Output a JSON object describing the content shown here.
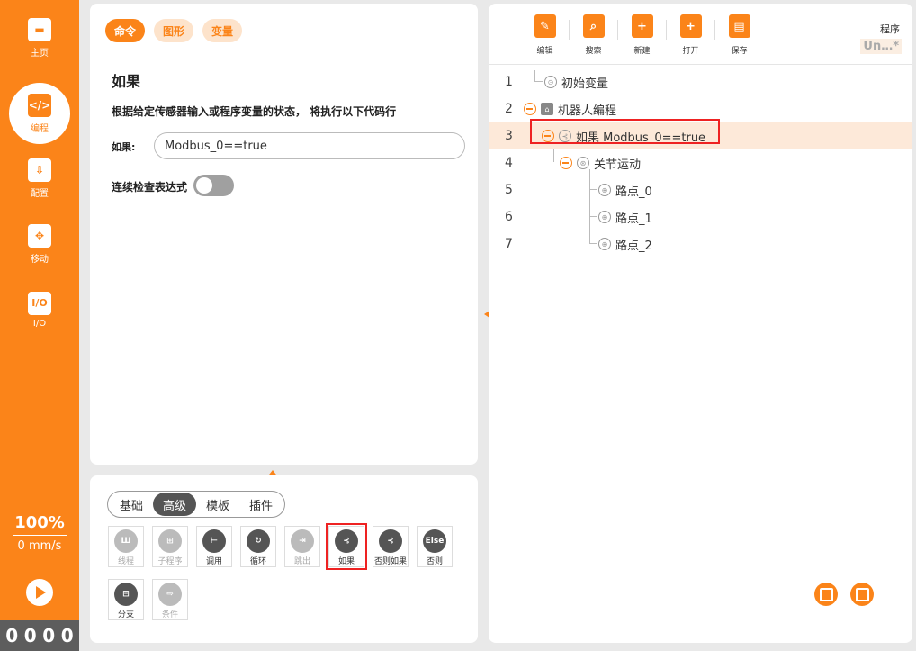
{
  "sidebar": {
    "items": [
      {
        "label": "主页",
        "icon": "home-icon"
      },
      {
        "label": "编程",
        "icon": "code-icon"
      },
      {
        "label": "配置",
        "icon": "config-icon"
      },
      {
        "label": "移动",
        "icon": "move-icon"
      },
      {
        "label": "I/O",
        "icon": "io-icon"
      }
    ],
    "speed_percent": "100%",
    "speed_value": "0 mm/s",
    "io_digits": [
      "0",
      "0",
      "0",
      "0"
    ]
  },
  "command_panel": {
    "tabs": [
      "命令",
      "图形",
      "变量"
    ],
    "title": "如果",
    "description": "根据给定传感器输入或程序变量的状态， 将执行以下代码行",
    "if_label": "如果:",
    "if_value": "Modbus_0==true",
    "continuous_label": "连续检查表达式"
  },
  "toolbox": {
    "categories": [
      "基础",
      "高级",
      "模板",
      "插件"
    ],
    "tools": [
      "线程",
      "子程序",
      "调用",
      "循环",
      "跳出",
      "如果",
      "否则如果",
      "否则",
      "分支",
      "条件"
    ],
    "else_glyph": "Else"
  },
  "program": {
    "toolbar": [
      "编辑",
      "搜索",
      "新建",
      "打开",
      "保存"
    ],
    "label": "程序",
    "name": "Un…*",
    "rows": [
      {
        "num": "1",
        "text": "初始变量"
      },
      {
        "num": "2",
        "text": "机器人编程"
      },
      {
        "num": "3",
        "text": "如果 Modbus_0==true"
      },
      {
        "num": "4",
        "text": "关节运动"
      },
      {
        "num": "5",
        "text": "路点_0"
      },
      {
        "num": "6",
        "text": "路点_1"
      },
      {
        "num": "7",
        "text": "路点_2"
      }
    ]
  },
  "colors": {
    "accent": "#fb8419",
    "highlight": "#e22222"
  }
}
